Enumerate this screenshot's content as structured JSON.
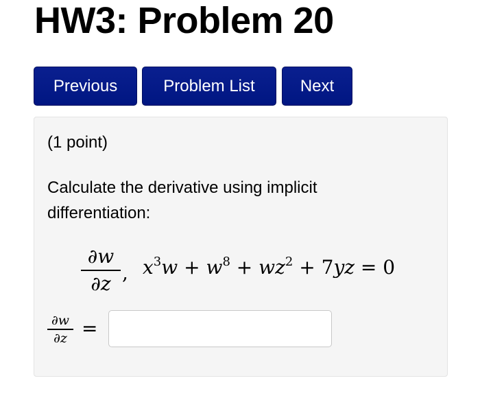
{
  "page": {
    "title": "HW3: Problem 20"
  },
  "nav": {
    "previous_label": "Previous",
    "problem_list_label": "Problem List",
    "next_label": "Next"
  },
  "problem": {
    "points": "(1 point)",
    "statement": "Calculate the derivative using implicit differentiation:",
    "derivative_numerator": "∂w",
    "derivative_denominator": "∂z",
    "separator": ",",
    "equation": {
      "t1_base": "x",
      "t1_exp": "3",
      "t1_tail": "w",
      "plus1": " + ",
      "t2_base": "w",
      "t2_exp": "8",
      "plus2": " + ",
      "t3_base": "wz",
      "t3_exp": "2",
      "plus3": " + ",
      "t4_coef": "7",
      "t4_vars": "yz",
      "equals": " = ",
      "rhs": "0"
    },
    "answer": {
      "lhs_numerator": "∂w",
      "lhs_denominator": "∂z",
      "equals": "=",
      "value": "",
      "placeholder": ""
    }
  }
}
